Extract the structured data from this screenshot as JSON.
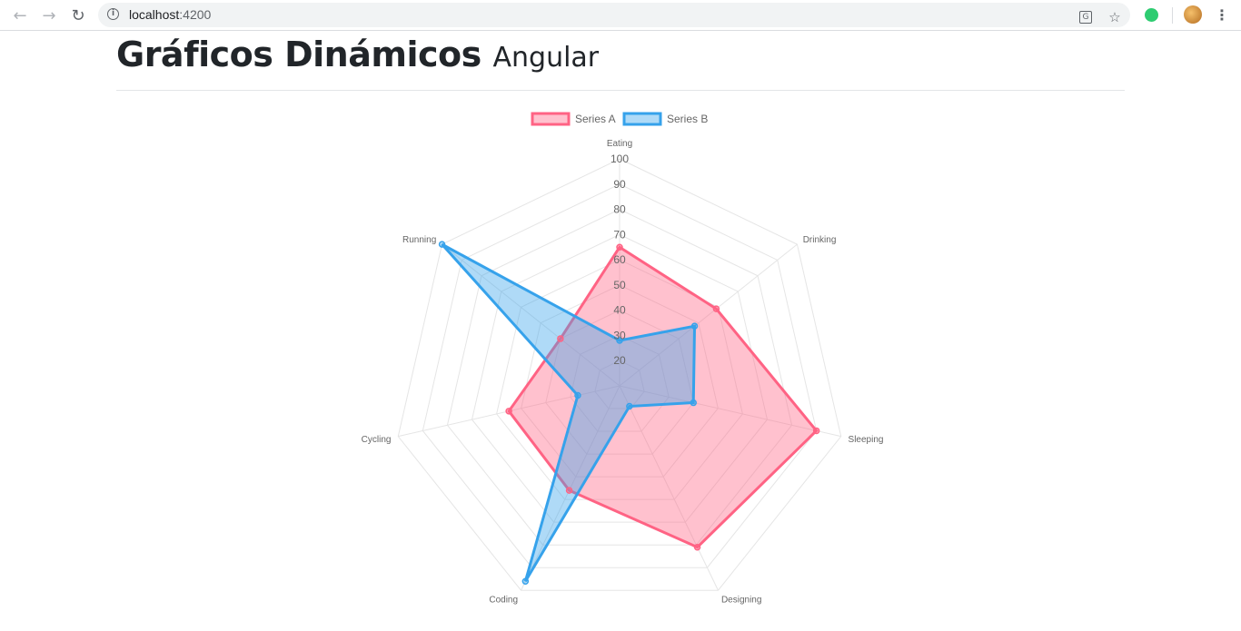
{
  "browser": {
    "url_host": "localhost",
    "url_port": ":4200",
    "back_icon": "arrow-left-icon",
    "forward_icon": "arrow-right-icon",
    "reload_icon": "reload-icon",
    "info_icon": "info-icon",
    "translate_icon": "translate-icon",
    "bookmark_icon": "star-icon",
    "extension_icon": "extension-icon",
    "profile_icon": "avatar-icon",
    "menu_icon": "kebab-menu-icon"
  },
  "page": {
    "title": "Gráficos Dinámicos",
    "subtitle": "Angular"
  },
  "chart_data": {
    "type": "radar",
    "labels": [
      "Eating",
      "Drinking",
      "Sleeping",
      "Designing",
      "Coding",
      "Cycling",
      "Running"
    ],
    "ticks": [
      "20",
      "30",
      "40",
      "50",
      "60",
      "70",
      "80",
      "90",
      "100"
    ],
    "scale": {
      "min": 10,
      "max": 100,
      "step": 10
    },
    "series": [
      {
        "name": "Series A",
        "values": [
          65,
          59,
          90,
          81,
          56,
          55,
          40
        ],
        "color": "#ff6384",
        "fill": "rgba(255,99,132,0.4)"
      },
      {
        "name": "Series B",
        "values": [
          28,
          48,
          40,
          19,
          96,
          27,
          100
        ],
        "color": "#36a2eb",
        "fill": "rgba(54,162,235,0.4)"
      }
    ],
    "legend_position": "top",
    "grid": true
  }
}
